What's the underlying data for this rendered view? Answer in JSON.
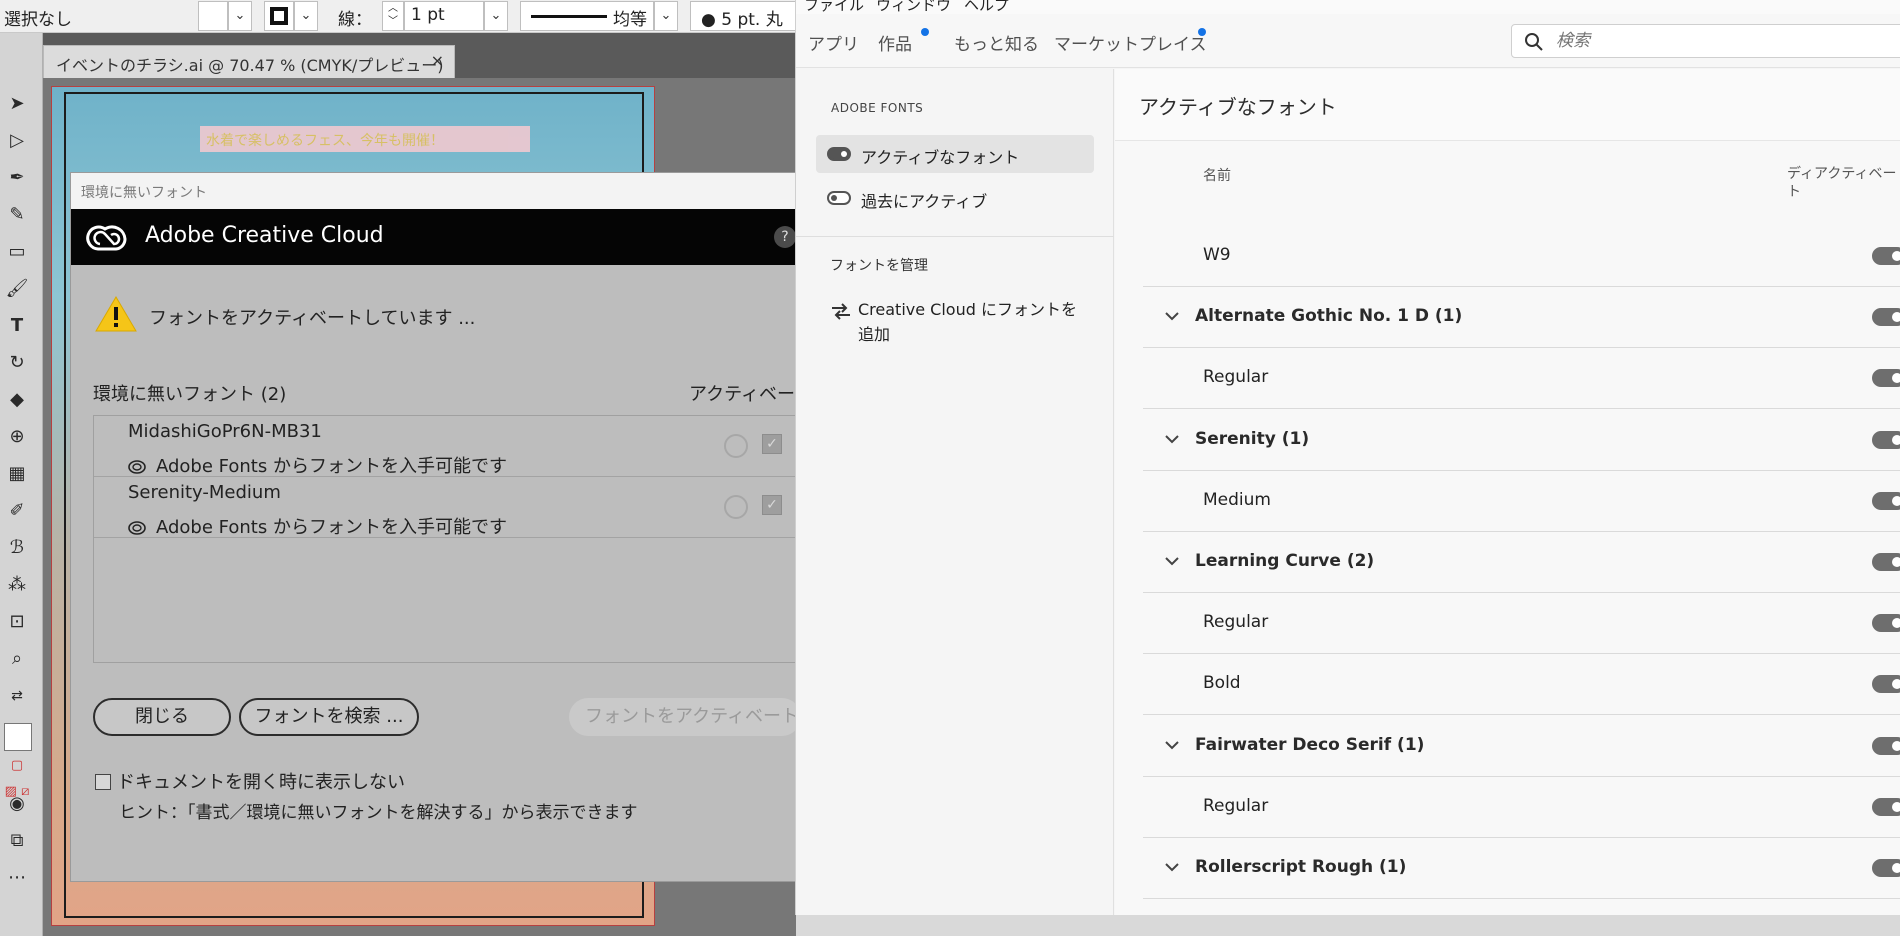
{
  "illustrator": {
    "control_bar": {
      "selection": "選択なし",
      "stroke_label": "線：",
      "stroke_weight": "1 pt",
      "stroke_profile": "均等",
      "brush": "5 pt. 丸"
    },
    "document_tab": {
      "title": "イベントのチラシ.ai @ 70.47 % (CMYK/プレビュー)",
      "close": "×"
    },
    "artboard": {
      "headline": "水着で楽しめるフェス、今年も開催！"
    }
  },
  "dialog": {
    "window_title": "環境に無いフォント",
    "brand": "Adobe Creative Cloud",
    "help": "?",
    "status": "フォントをアクティベートしています ...",
    "list_header": "環境に無いフォント (2)",
    "activate_header": "アクティベー",
    "fonts": [
      {
        "name": "MidashiGoPr6N-MB31",
        "source": "Adobe Fonts からフォントを入手可能です"
      },
      {
        "name": "Serenity-Medium",
        "source": "Adobe Fonts からフォントを入手可能です"
      }
    ],
    "buttons": {
      "close": "閉じる",
      "find": "フォントを検索 ...",
      "activate": "フォントをアクティベート"
    },
    "dont_show": "ドキュメントを開く時に表示しない",
    "hint": "ヒント：「書式／環境に無いフォントを解決する」から表示できます"
  },
  "cc": {
    "menubar": [
      "ファイル",
      "ウィンドウ",
      "ヘルプ"
    ],
    "nav": {
      "apps": "アプリ",
      "works": "作品",
      "learn": "もっと知る",
      "marketplace": "マーケットプレイス"
    },
    "search_placeholder": "検索",
    "sidebar": {
      "section": "ADOBE FONTS",
      "active": "アクティブなフォント",
      "previous": "過去にアクティブ",
      "manage_header": "フォントを管理",
      "add_fonts": "Creative Cloud にフォントを追加"
    },
    "main": {
      "heading": "アクティブなフォント",
      "col_name": "名前",
      "col_deactivate": "ディアクティベート",
      "rows": [
        {
          "kind": "style",
          "name": "W9"
        },
        {
          "kind": "family",
          "name": "Alternate Gothic No. 1 D (1)"
        },
        {
          "kind": "style",
          "name": "Regular"
        },
        {
          "kind": "family",
          "name": "Serenity (1)"
        },
        {
          "kind": "style",
          "name": "Medium"
        },
        {
          "kind": "family",
          "name": "Learning Curve (2)"
        },
        {
          "kind": "style",
          "name": "Regular"
        },
        {
          "kind": "style",
          "name": "Bold"
        },
        {
          "kind": "family",
          "name": "Fairwater Deco Serif (1)"
        },
        {
          "kind": "style",
          "name": "Regular"
        },
        {
          "kind": "family",
          "name": "Rollerscript Rough (1)"
        }
      ]
    }
  },
  "colors": {
    "accent_blue": "#1473e6",
    "toggle_on": "#6e6e6e",
    "dialog_bg": "#bdbdbd",
    "cc_header": "#050505"
  }
}
